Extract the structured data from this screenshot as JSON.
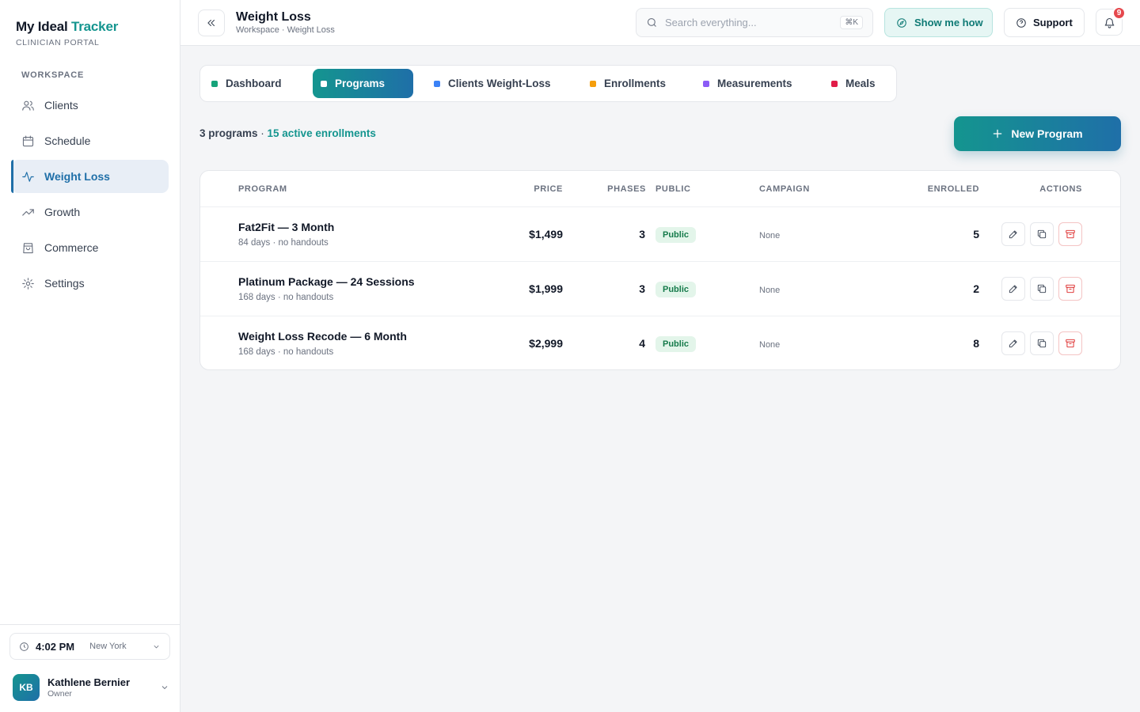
{
  "brand": {
    "name_part1": "My Ideal",
    "name_part2": "Tracker",
    "subtitle": "CLINICIAN PORTAL"
  },
  "sidebar": {
    "section_label": "WORKSPACE",
    "items": [
      {
        "label": "Clients",
        "icon": "users-icon"
      },
      {
        "label": "Schedule",
        "icon": "calendar-icon"
      },
      {
        "label": "Weight Loss",
        "icon": "activity-icon",
        "active": true
      },
      {
        "label": "Growth",
        "icon": "trending-up-icon"
      },
      {
        "label": "Commerce",
        "icon": "shopping-bag-icon"
      },
      {
        "label": "Settings",
        "icon": "gear-icon"
      }
    ],
    "clock": {
      "time": "4:02 PM",
      "zone": "New York"
    },
    "user": {
      "initials": "KB",
      "name": "Kathlene Bernier",
      "role": "Owner"
    }
  },
  "header": {
    "title": "Weight Loss",
    "breadcrumb": "Workspace · Weight Loss",
    "search_placeholder": "Search everything...",
    "search_shortcut": "⌘K",
    "show_me_label": "Show me how",
    "support_label": "Support",
    "notification_count": "9"
  },
  "tabs": [
    {
      "label": "Dashboard",
      "color": "#16a37a"
    },
    {
      "label": "Programs",
      "color": "#ffffff",
      "active": true
    },
    {
      "label": "Clients Weight-Loss",
      "color": "#3b82f6"
    },
    {
      "label": "Enrollments",
      "color": "#f59e0b"
    },
    {
      "label": "Measurements",
      "color": "#8b5cf6"
    },
    {
      "label": "Meals",
      "color": "#e11d48"
    }
  ],
  "summary": {
    "count": "3 programs",
    "separator": " · ",
    "active": "15 active enrollments"
  },
  "new_program_label": "New Program",
  "table": {
    "columns": {
      "program": "PROGRAM",
      "price": "PRICE",
      "phases": "PHASES",
      "public": "PUBLIC",
      "campaign": "CAMPAIGN",
      "enrolled": "ENROLLED",
      "actions": "ACTIONS"
    },
    "rows": [
      {
        "name": "Fat2Fit — 3 Month",
        "meta": "84 days · no handouts",
        "price": "$1,499",
        "phases": "3",
        "public": "Public",
        "campaign": "None",
        "enrolled": "5"
      },
      {
        "name": "Platinum Package — 24 Sessions",
        "meta": "168 days · no handouts",
        "price": "$1,999",
        "phases": "3",
        "public": "Public",
        "campaign": "None",
        "enrolled": "2"
      },
      {
        "name": "Weight Loss Recode — 6 Month",
        "meta": "168 days · no handouts",
        "price": "$2,999",
        "phases": "4",
        "public": "Public",
        "campaign": "None",
        "enrolled": "8"
      }
    ]
  }
}
